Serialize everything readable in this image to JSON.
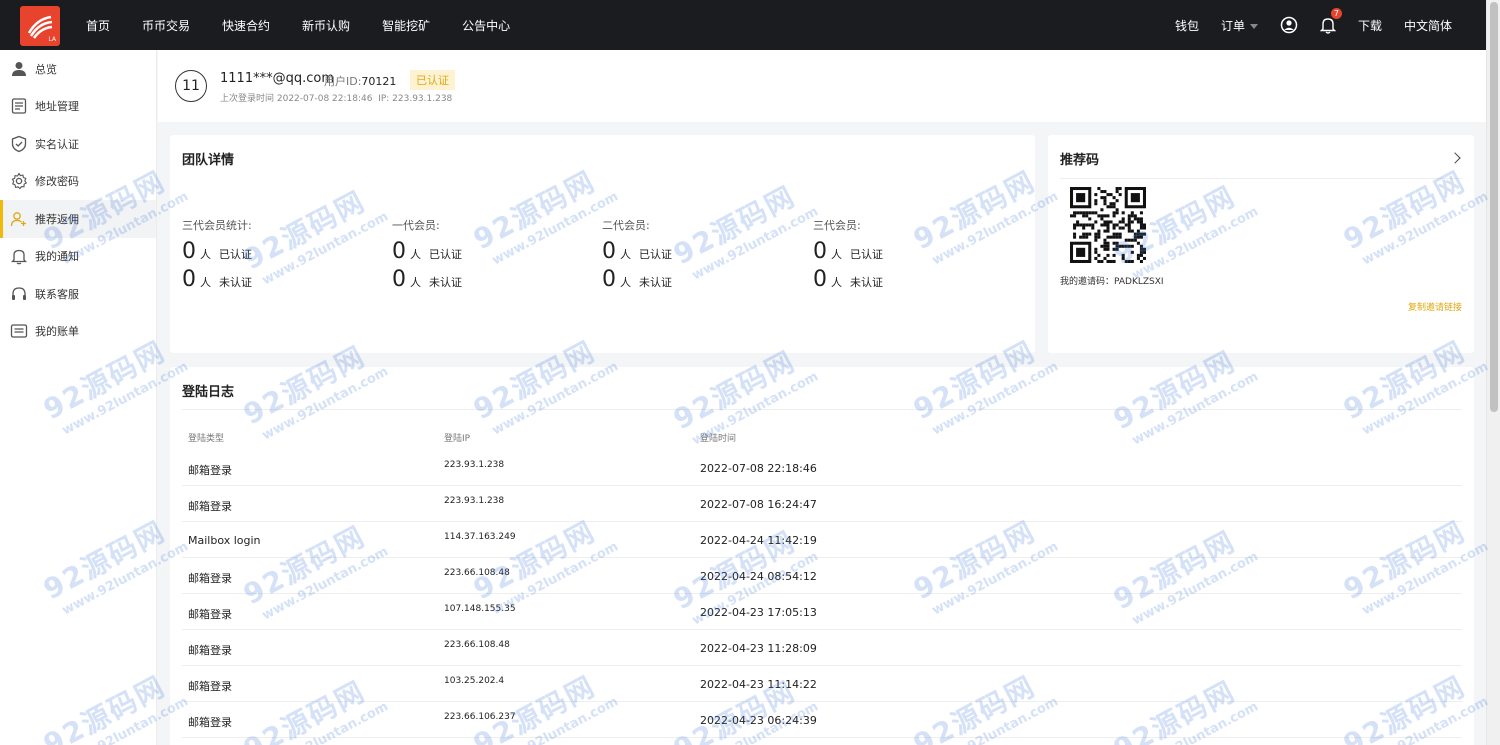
{
  "nav": {
    "logo_text": "LA",
    "items": [
      "首页",
      "币币交易",
      "快速合约",
      "新币认购",
      "智能挖矿",
      "公告中心"
    ],
    "right": {
      "wallet": "钱包",
      "orders": "订单",
      "notification_count": "7",
      "download": "下载",
      "language": "中文简体"
    }
  },
  "sidebar": {
    "items": [
      {
        "label": "总览",
        "icon": "user-icon"
      },
      {
        "label": "地址管理",
        "icon": "list-icon"
      },
      {
        "label": "实名认证",
        "icon": "shield-icon"
      },
      {
        "label": "修改密码",
        "icon": "gear-icon"
      },
      {
        "label": "推荐返佣",
        "icon": "add-user-icon",
        "active": true
      },
      {
        "label": "我的通知",
        "icon": "bell-icon"
      },
      {
        "label": "联系客服",
        "icon": "headset-icon"
      },
      {
        "label": "我的账单",
        "icon": "bill-icon"
      }
    ]
  },
  "user": {
    "avatar": "11",
    "email": "1111***@qq.com",
    "uid_label": "用户ID:",
    "uid": "70121",
    "status": "已认证",
    "last_login": "上次登录时间 2022-07-08 22:18:46",
    "ip": "IP: 223.93.1.238"
  },
  "team": {
    "title": "团队详情",
    "groups": [
      {
        "label": "三代会员统计:",
        "verified": "0",
        "unverified": "0"
      },
      {
        "label": "一代会员:",
        "verified": "0",
        "unverified": "0"
      },
      {
        "label": "二代会员:",
        "verified": "0",
        "unverified": "0"
      },
      {
        "label": "三代会员:",
        "verified": "0",
        "unverified": "0"
      }
    ],
    "unit": "人",
    "verified_label": "已认证",
    "unverified_label": "未认证"
  },
  "referral": {
    "title": "推荐码",
    "invite_code": "我的邀请码：PADKLZSXI",
    "copy_link": "复制邀请链接"
  },
  "log": {
    "title": "登陆日志",
    "headers": [
      "登陆类型",
      "登陆IP",
      "登陆时间"
    ],
    "rows": [
      {
        "type": "邮箱登录",
        "ip": "223.93.1.238",
        "time": "2022-07-08 22:18:46"
      },
      {
        "type": "邮箱登录",
        "ip": "223.93.1.238",
        "time": "2022-07-08 16:24:47"
      },
      {
        "type": "Mailbox login",
        "ip": "114.37.163.249",
        "time": "2022-04-24 11:42:19"
      },
      {
        "type": "邮箱登录",
        "ip": "223.66.108.48",
        "time": "2022-04-24 08:54:12"
      },
      {
        "type": "邮箱登录",
        "ip": "107.148.155.35",
        "time": "2022-04-23 17:05:13"
      },
      {
        "type": "邮箱登录",
        "ip": "223.66.108.48",
        "time": "2022-04-23 11:28:09"
      },
      {
        "type": "邮箱登录",
        "ip": "103.25.202.4",
        "time": "2022-04-23 11:14:22"
      },
      {
        "type": "邮箱登录",
        "ip": "223.66.106.237",
        "time": "2022-04-23 06:24:39"
      }
    ]
  },
  "watermark": {
    "big": "92源码网",
    "small": "www.92luntan.com"
  }
}
